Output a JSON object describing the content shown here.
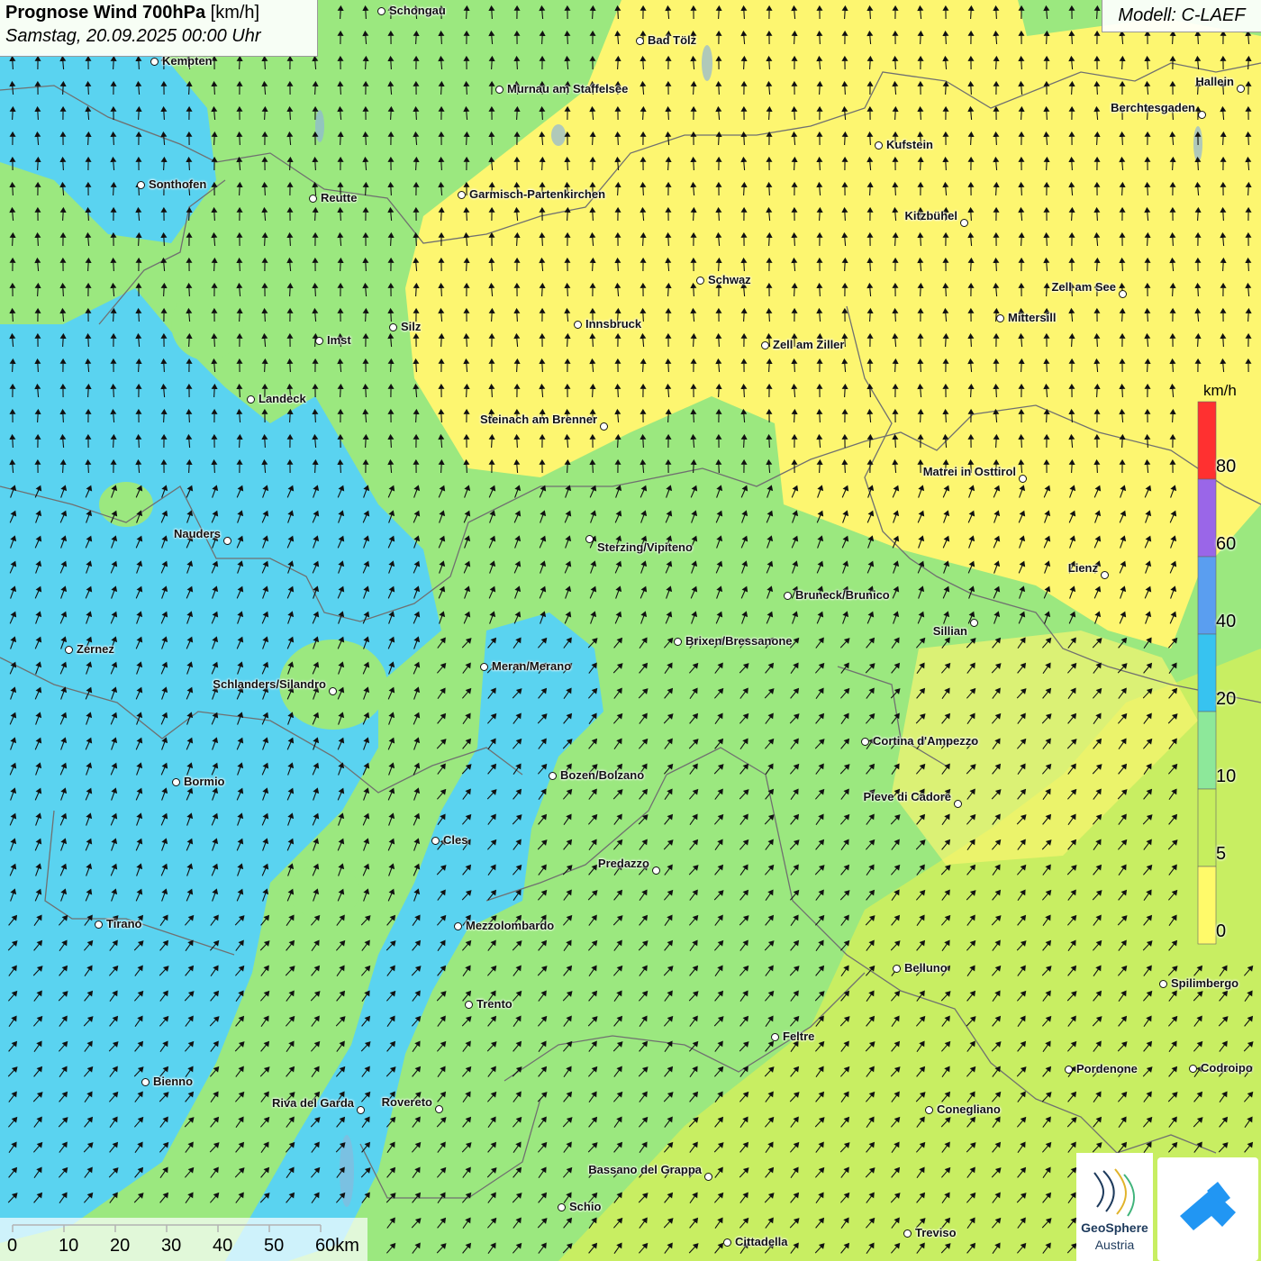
{
  "title": {
    "main": "Prognose Wind 700hPa",
    "unit": "[km/h]",
    "datetime": "Samstag, 20.09.2025 00:00 Uhr"
  },
  "model_label": "Modell: C-LAEF",
  "legend": {
    "unit": "km/h",
    "labels": [
      "80",
      "60",
      "40",
      "20",
      "10",
      "5",
      "0"
    ],
    "colors": [
      "#ff3030",
      "#9a66e8",
      "#5a9ef0",
      "#37c3f0",
      "#8de89a",
      "#c6ee5e",
      "#fffa6a"
    ]
  },
  "scale": {
    "labels": [
      "0",
      "10",
      "20",
      "30",
      "40",
      "50",
      "60km"
    ]
  },
  "logos": {
    "geosphere_line1": "GeoSphere",
    "geosphere_line2": "Austria"
  },
  "colors": {
    "calm": "#fdf670",
    "light": "#c8ee62",
    "moderate": "#9be87f",
    "strong": "#5ad3f0"
  },
  "cities": [
    {
      "name": "Schongau"
    },
    {
      "name": "Bad Tölz"
    },
    {
      "name": "Kempten"
    },
    {
      "name": "Murnau am Staffelsee"
    },
    {
      "name": "Hallein"
    },
    {
      "name": "Berchtesgaden"
    },
    {
      "name": "Kufstein"
    },
    {
      "name": "Sonthofen"
    },
    {
      "name": "Reutte"
    },
    {
      "name": "Garmisch-Partenkirchen"
    },
    {
      "name": "Kitzbühel"
    },
    {
      "name": "Schwaz"
    },
    {
      "name": "Zell am See"
    },
    {
      "name": "Mittersill"
    },
    {
      "name": "Silz"
    },
    {
      "name": "Innsbruck"
    },
    {
      "name": "Imst"
    },
    {
      "name": "Zell am Ziller"
    },
    {
      "name": "Landeck"
    },
    {
      "name": "Steinach am Brenner"
    },
    {
      "name": "Matrei in Osttirol"
    },
    {
      "name": "Nauders"
    },
    {
      "name": "Sterzing/Vipiteno"
    },
    {
      "name": "Lienz"
    },
    {
      "name": "Bruneck/Brunico"
    },
    {
      "name": "Sillian"
    },
    {
      "name": "Brixen/Bressanone"
    },
    {
      "name": "Zernez"
    },
    {
      "name": "Meran/Merano"
    },
    {
      "name": "Schlanders/Silandro"
    },
    {
      "name": "Cortina d'Ampezzo"
    },
    {
      "name": "Bozen/Bolzano"
    },
    {
      "name": "Bormio"
    },
    {
      "name": "Pieve di Cadore"
    },
    {
      "name": "Cles"
    },
    {
      "name": "Predazzo"
    },
    {
      "name": "Tirano"
    },
    {
      "name": "Mezzolombardo"
    },
    {
      "name": "Belluno"
    },
    {
      "name": "Spilimbergo"
    },
    {
      "name": "Trento"
    },
    {
      "name": "Feltre"
    },
    {
      "name": "Pordenone"
    },
    {
      "name": "Codroipo"
    },
    {
      "name": "Bienno"
    },
    {
      "name": "Riva del Garda"
    },
    {
      "name": "Rovereto"
    },
    {
      "name": "Conegliano"
    },
    {
      "name": "Bassano del Grappa"
    },
    {
      "name": "Schio"
    },
    {
      "name": "Treviso"
    },
    {
      "name": "Cittadella"
    }
  ]
}
